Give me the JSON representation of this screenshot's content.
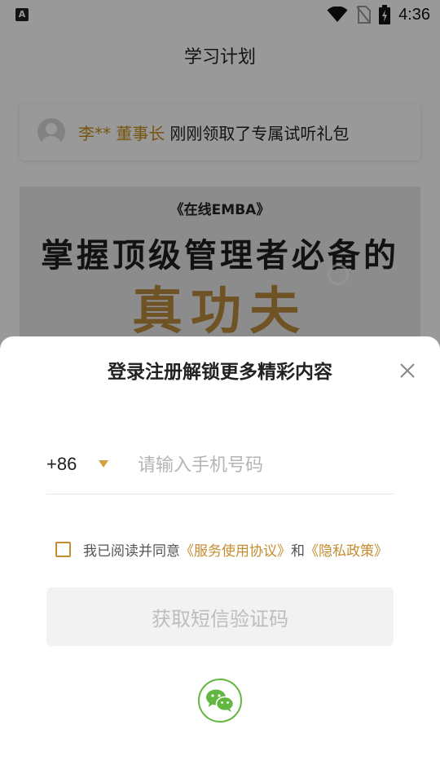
{
  "status_bar": {
    "time": "4:36",
    "app_icon_letter": "A",
    "icons": [
      "wifi-icon",
      "no-sim-icon",
      "battery-charging-icon"
    ]
  },
  "page": {
    "title": "学习计划",
    "notice": {
      "name": "李** 董事长",
      "text": "刚刚领取了专属试听礼包"
    },
    "banner": {
      "tag": "《在线EMBA》",
      "line1": "掌握顶级管理者必备的",
      "line2": "真功夫"
    }
  },
  "login_sheet": {
    "title": "登录注册解锁更多精彩内容",
    "close_icon": "close-icon",
    "country_code": "+86",
    "phone_placeholder": "请输入手机号码",
    "agreement": {
      "prefix": "我已阅读并同意",
      "service_link": "《服务使用协议》",
      "joiner": "和",
      "privacy_link": "《隐私政策》",
      "checked": false
    },
    "get_code_label": "获取短信验证码",
    "wechat_icon": "wechat-icon"
  },
  "colors": {
    "accent_gold": "#c48d30",
    "wechat_green": "#62b740",
    "overlay": "rgba(0,0,0,0.4)"
  }
}
